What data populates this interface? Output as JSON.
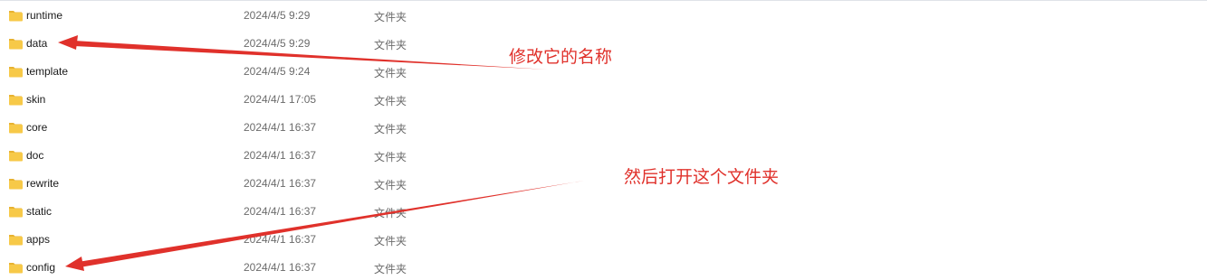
{
  "files": [
    {
      "name": "runtime",
      "modified": "2024/4/5 9:29",
      "type": "文件夹"
    },
    {
      "name": "data",
      "modified": "2024/4/5 9:29",
      "type": "文件夹"
    },
    {
      "name": "template",
      "modified": "2024/4/5 9:24",
      "type": "文件夹"
    },
    {
      "name": "skin",
      "modified": "2024/4/1 17:05",
      "type": "文件夹"
    },
    {
      "name": "core",
      "modified": "2024/4/1 16:37",
      "type": "文件夹"
    },
    {
      "name": "doc",
      "modified": "2024/4/1 16:37",
      "type": "文件夹"
    },
    {
      "name": "rewrite",
      "modified": "2024/4/1 16:37",
      "type": "文件夹"
    },
    {
      "name": "static",
      "modified": "2024/4/1 16:37",
      "type": "文件夹"
    },
    {
      "name": "apps",
      "modified": "2024/4/1 16:37",
      "type": "文件夹"
    },
    {
      "name": "config",
      "modified": "2024/4/1 16:37",
      "type": "文件夹"
    }
  ],
  "annotations": {
    "rename_note": "修改它的名称",
    "open_note": "然后打开这个文件夹"
  },
  "colors": {
    "annotation": "#e0312b",
    "folder_body": "#f7c948",
    "folder_tab": "#e8b230"
  },
  "icons": {
    "folder": "folder-icon",
    "arrow": "red-arrow"
  }
}
